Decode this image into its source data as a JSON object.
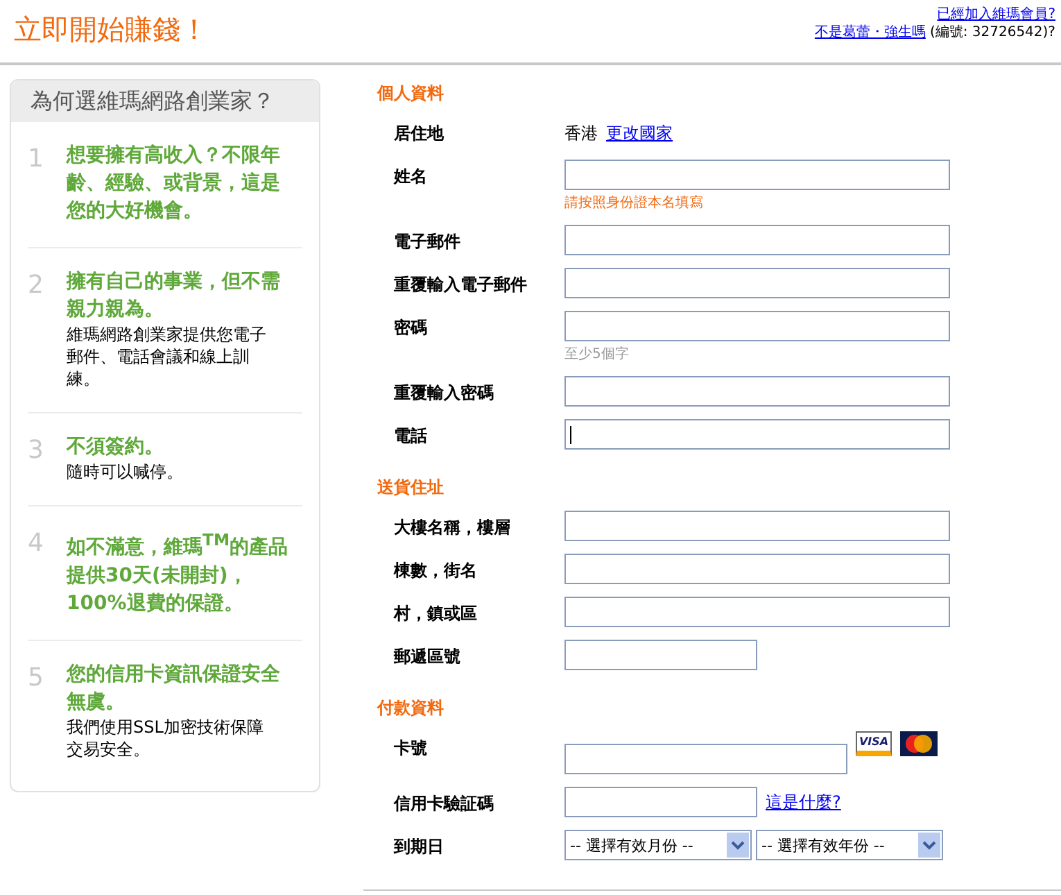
{
  "header": {
    "title": "立即開始賺錢！",
    "member_link": "已經加入維瑪會員?",
    "not_me_link": "不是葛蕾・強生嗎",
    "member_id": "(編號: 32726542)?"
  },
  "sidebar": {
    "title": "為何選維瑪網路創業家？",
    "items": [
      {
        "number": "1",
        "heading": "想要擁有高收入？不限年齡、經驗、或背景，這是您的大好機會。"
      },
      {
        "number": "2",
        "heading": "擁有自己的事業，但不需親力親為。",
        "text": "維瑪網路創業家提供您電子郵件、電話會議和線上訓練。"
      },
      {
        "number": "3",
        "heading": "不須簽約。",
        "text": "隨時可以喊停。"
      },
      {
        "number": "4",
        "heading": "如不滿意，維瑪$^{TM}$的產品提供30天(未開封)，100%退費的保證。"
      },
      {
        "number": "5",
        "heading": "您的信用卡資訊保證安全無虞。",
        "text": "我們使用SSL加密技術保障交易安全。"
      }
    ]
  },
  "sections": [
    {
      "title": "個人資料",
      "rows": [
        {
          "kind": "info",
          "label": "居住地",
          "value": "香港",
          "link": "更改國家"
        },
        {
          "kind": "text",
          "label": "姓名",
          "hint": {
            "kind": "warning",
            "text": "請按照身份證本名填寫"
          }
        },
        {
          "kind": "text",
          "label": "電子郵件"
        },
        {
          "kind": "text",
          "label": "重覆輸入電子郵件"
        },
        {
          "kind": "text",
          "label": "密碼",
          "hint": {
            "kind": "note",
            "text": "至少5個字"
          }
        },
        {
          "kind": "text",
          "label": "重覆輸入密碼"
        },
        {
          "kind": "text",
          "label": "電話",
          "focused": true
        }
      ]
    },
    {
      "title": "送貨住址",
      "rows": [
        {
          "kind": "text",
          "label": "大樓名稱，樓層"
        },
        {
          "kind": "text",
          "label": "棟數，街名"
        },
        {
          "kind": "text",
          "label": "村，鎮或區"
        },
        {
          "kind": "short_text",
          "label": "郵遞區號"
        }
      ]
    },
    {
      "title": "付款資料",
      "rows": [
        {
          "kind": "card",
          "label": "卡號",
          "card_logo": "VISA"
        },
        {
          "kind": "short_text",
          "label": "信用卡驗証碼",
          "link": "這是什麼?"
        },
        {
          "kind": "select",
          "label": "到期日",
          "selects": [
            "-- 選擇有效月份 --",
            "-- 選擇有效年份 --"
          ]
        }
      ]
    }
  ]
}
